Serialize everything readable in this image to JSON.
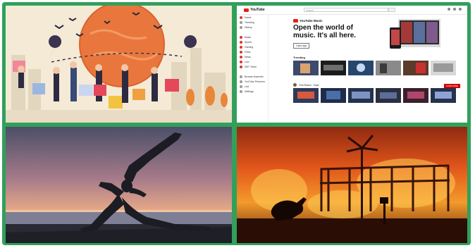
{
  "collage": {
    "border_color": "#31a05a",
    "panels": [
      {
        "id": "travel",
        "kind": "illustration",
        "subject": "travelers-with-luggage-and-map-pins"
      },
      {
        "id": "youtube",
        "kind": "screenshot",
        "subject": "youtube-music-homepage"
      },
      {
        "id": "yoga",
        "kind": "photo",
        "subject": "yoga-silhouette-at-sunset"
      },
      {
        "id": "fire",
        "kind": "photo",
        "subject": "kangaroo-bushfire"
      }
    ]
  },
  "youtube": {
    "logo_text": "YouTube",
    "search_placeholder": "Search",
    "sidebar": [
      {
        "label": "Home"
      },
      {
        "label": "Trending"
      },
      {
        "label": "History"
      }
    ],
    "sidebar_more": [
      {
        "label": "Music"
      },
      {
        "label": "Sports"
      },
      {
        "label": "Gaming"
      },
      {
        "label": "Films"
      },
      {
        "label": "News"
      },
      {
        "label": "Live"
      },
      {
        "label": "360° Video"
      }
    ],
    "sidebar_bottom": [
      {
        "label": "Browse channels"
      },
      {
        "label": "YouTube Premium"
      },
      {
        "label": "Live"
      },
      {
        "label": "Settings"
      }
    ],
    "brand": "YouTube Music",
    "headline": "Open the world of music. It's all here.",
    "open_button": "Open app",
    "trending_label": "Trending",
    "channel_label": "Tom Rosen - Topic",
    "subscribe_label": "SUBSCRIBE",
    "colors": {
      "accent": "#e62117"
    }
  }
}
